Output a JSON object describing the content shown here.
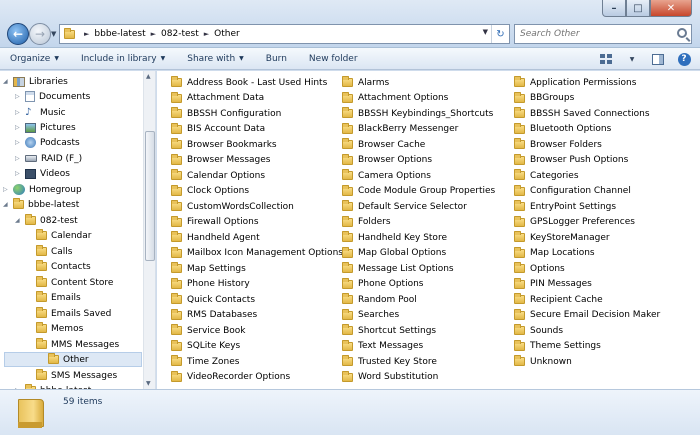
{
  "window": {
    "min_glyph": "–",
    "max_glyph": "□",
    "close_glyph": "✕"
  },
  "nav": {
    "back_icon": "back-arrow-icon",
    "forward_icon": "forward-arrow-icon",
    "back_glyph": "←",
    "forward_glyph": "→",
    "dropdown_glyph": "▼"
  },
  "address": {
    "crumbs": [
      "bbbe-latest",
      "082-test",
      "Other"
    ],
    "refresh_glyph": "↻"
  },
  "search": {
    "placeholder": "Search Other"
  },
  "toolbar": {
    "organize": "Organize",
    "include_in_library": "Include in library",
    "share_with": "Share with",
    "burn": "Burn",
    "new_folder": "New folder",
    "caret": "▼",
    "help_glyph": "?"
  },
  "sidebar": {
    "items": [
      {
        "label": "Libraries",
        "icon": "libraries-icon",
        "expander": "◢",
        "indent": 0
      },
      {
        "label": "Documents",
        "icon": "documents-icon",
        "expander": "▷",
        "indent": 1
      },
      {
        "label": "Music",
        "icon": "music-icon",
        "expander": "▷",
        "indent": 1
      },
      {
        "label": "Pictures",
        "icon": "pictures-icon",
        "expander": "▷",
        "indent": 1
      },
      {
        "label": "Podcasts",
        "icon": "podcasts-icon",
        "expander": "▷",
        "indent": 1
      },
      {
        "label": "RAID (F_)",
        "icon": "drive-icon",
        "expander": "▷",
        "indent": 1
      },
      {
        "label": "Videos",
        "icon": "videos-icon",
        "expander": "▷",
        "indent": 1
      },
      {
        "label": "Homegroup",
        "icon": "homegroup-icon",
        "expander": "▷",
        "indent": 0
      },
      {
        "label": "bbbe-latest",
        "icon": "folder-icon",
        "expander": "◢",
        "indent": 0
      },
      {
        "label": "082-test",
        "icon": "folder-icon",
        "expander": "◢",
        "indent": 1
      },
      {
        "label": "Calendar",
        "icon": "folder-icon",
        "expander": "",
        "indent": 2
      },
      {
        "label": "Calls",
        "icon": "folder-icon",
        "expander": "",
        "indent": 2
      },
      {
        "label": "Contacts",
        "icon": "folder-icon",
        "expander": "",
        "indent": 2
      },
      {
        "label": "Content Store",
        "icon": "folder-icon",
        "expander": "",
        "indent": 2
      },
      {
        "label": "Emails",
        "icon": "folder-icon",
        "expander": "",
        "indent": 2
      },
      {
        "label": "Emails Saved",
        "icon": "folder-icon",
        "expander": "",
        "indent": 2
      },
      {
        "label": "Memos",
        "icon": "folder-icon",
        "expander": "",
        "indent": 2
      },
      {
        "label": "MMS Messages",
        "icon": "folder-icon",
        "expander": "",
        "indent": 2
      },
      {
        "label": "Other",
        "icon": "folder-icon",
        "expander": "",
        "indent": 2,
        "selected": true
      },
      {
        "label": "SMS Messages",
        "icon": "folder-icon",
        "expander": "",
        "indent": 2
      },
      {
        "label": "bbbe-latest",
        "icon": "folder-icon",
        "expander": "▷",
        "indent": 1
      }
    ],
    "scroll_up_glyph": "▲",
    "scroll_down_glyph": "▼"
  },
  "files": {
    "columns": [
      [
        "Address Book - Last Used Hints",
        "Attachment Data",
        "BBSSH Configuration",
        "BIS Account Data",
        "Browser Bookmarks",
        "Browser Messages",
        "Calendar Options",
        "Clock Options",
        "CustomWordsCollection",
        "Firewall Options",
        "Handheld Agent",
        "Mailbox Icon Management Options",
        "Map Settings",
        "Phone History",
        "Quick Contacts",
        "RMS Databases",
        "Service Book",
        "SQLite Keys",
        "Time Zones",
        "VideoRecorder Options"
      ],
      [
        "Alarms",
        "Attachment Options",
        "BBSSH Keybindings_Shortcuts",
        "BlackBerry Messenger",
        "Browser Cache",
        "Browser Options",
        "Camera Options",
        "Code Module Group Properties",
        "Default Service Selector",
        "Folders",
        "Handheld Key Store",
        "Map Global Options",
        "Message List Options",
        "Phone Options",
        "Random Pool",
        "Searches",
        "Shortcut Settings",
        "Text Messages",
        "Trusted Key Store",
        "Word Substitution"
      ],
      [
        "Application Permissions",
        "BBGroups",
        "BBSSH Saved Connections",
        "Bluetooth Options",
        "Browser Folders",
        "Browser Push Options",
        "Categories",
        "Configuration Channel",
        "EntryPoint Settings",
        "GPSLogger Preferences",
        "KeyStoreManager",
        "Map Locations",
        "Options",
        "PIN Messages",
        "Recipient Cache",
        "Secure Email Decision Maker",
        "Sounds",
        "Theme Settings",
        "Unknown"
      ]
    ]
  },
  "details": {
    "item_count": "59 items"
  }
}
